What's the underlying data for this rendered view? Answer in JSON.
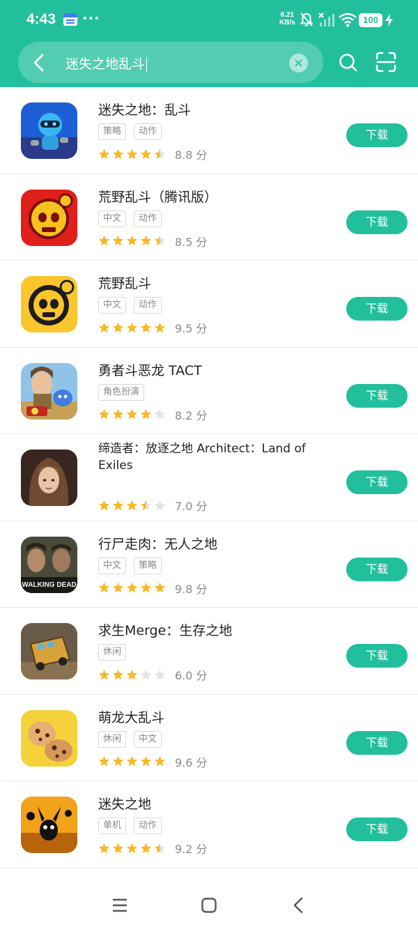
{
  "status_bar": {
    "time": "4:43",
    "dots": "···",
    "net_speed_value": "6.21",
    "net_speed_unit": "KB/s",
    "battery": "100"
  },
  "search": {
    "query": "迷失之地乱斗"
  },
  "colors": {
    "accent": "#22bf9d",
    "star_filled": "#f7b928",
    "star_empty": "#e2e2e2"
  },
  "apps": [
    {
      "name": "迷失之地：乱斗",
      "tags": [
        "策略",
        "动作"
      ],
      "stars": 4.5,
      "score": "8.8 分",
      "button": "下载"
    },
    {
      "name": "荒野乱斗（腾讯版）",
      "tags": [
        "中文",
        "动作"
      ],
      "stars": 4.5,
      "score": "8.5 分",
      "button": "下载"
    },
    {
      "name": "荒野乱斗",
      "tags": [
        "中文",
        "动作"
      ],
      "stars": 5,
      "score": "9.5 分",
      "button": "下载"
    },
    {
      "name": "勇者斗恶龙 TACT",
      "tags": [
        "角色扮演"
      ],
      "stars": 4,
      "score": "8.2 分",
      "button": "下载"
    },
    {
      "name": "缔造者：放逐之地 Architect：Land of Exiles",
      "tags": [],
      "stars": 3.5,
      "score": "7.0 分",
      "button": "下载"
    },
    {
      "name": "行尸走肉：无人之地",
      "tags": [
        "中文",
        "策略"
      ],
      "stars": 5,
      "score": "9.8 分",
      "button": "下载"
    },
    {
      "name": "求生Merge：生存之地",
      "tags": [
        "休闲"
      ],
      "stars": 3,
      "score": "6.0 分",
      "button": "下载"
    },
    {
      "name": "萌龙大乱斗",
      "tags": [
        "休闲",
        "中文"
      ],
      "stars": 5,
      "score": "9.6 分",
      "button": "下载"
    },
    {
      "name": "迷失之地",
      "tags": [
        "单机",
        "动作"
      ],
      "stars": 4.5,
      "score": "9.2 分",
      "button": "下载"
    }
  ]
}
